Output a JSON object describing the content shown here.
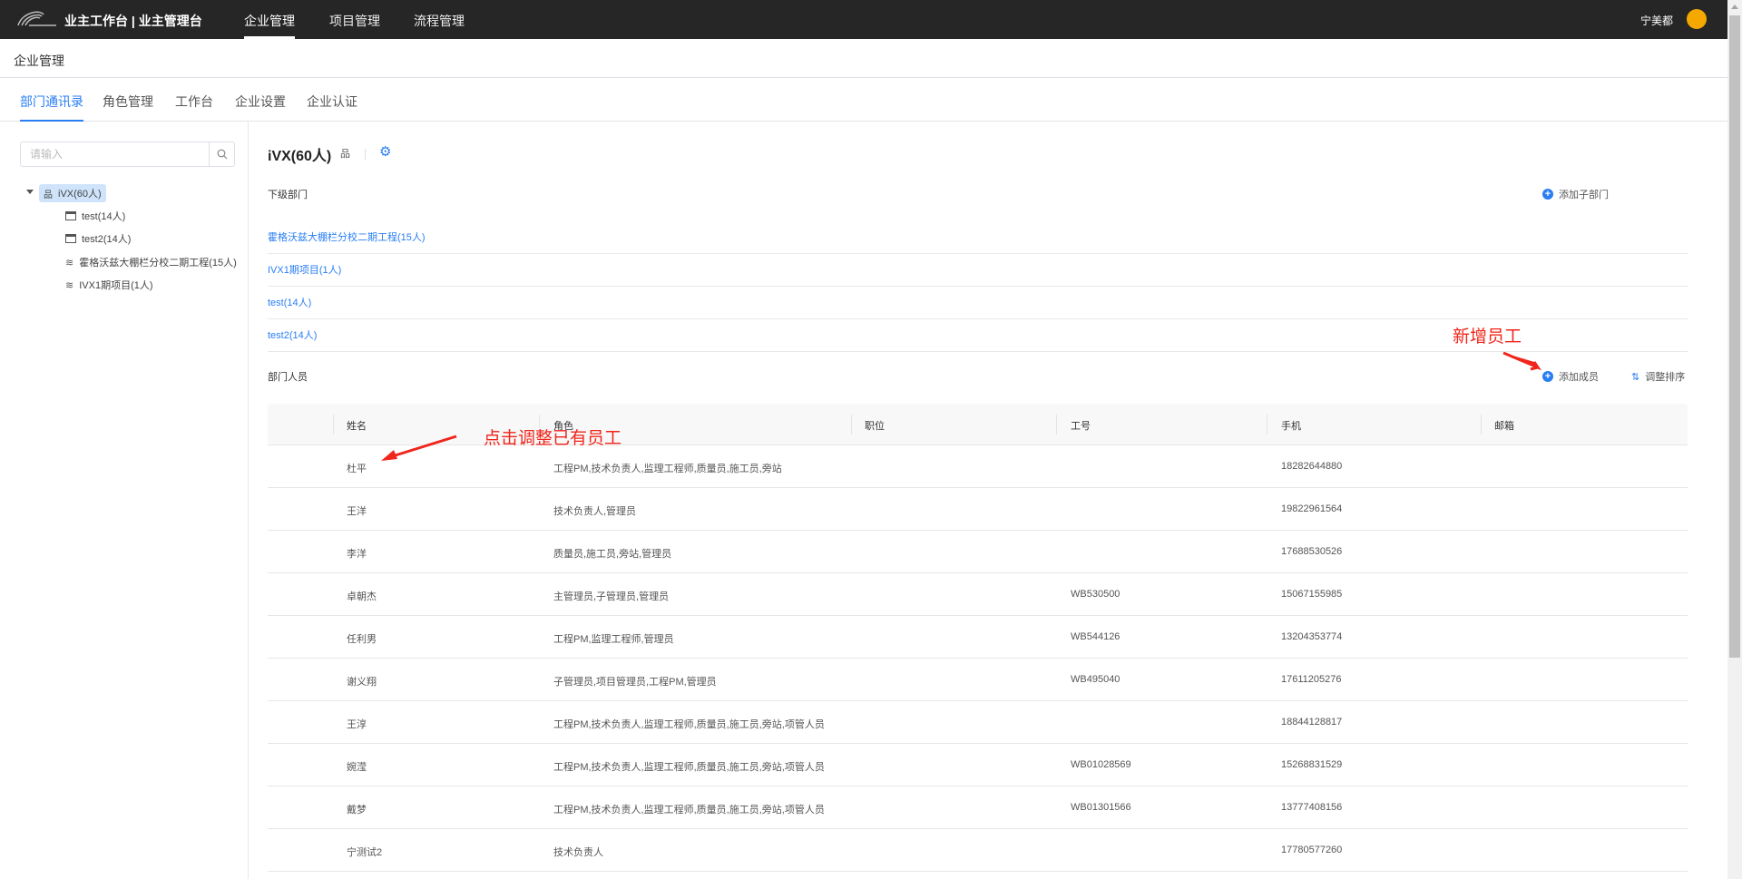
{
  "topbar": {
    "app_title": "业主工作台 | 业主管理台",
    "nav": [
      "企业管理",
      "项目管理",
      "流程管理"
    ],
    "user_name": "宁美都"
  },
  "breadcrumb": "企业管理",
  "tabs": [
    "部门通讯录",
    "角色管理",
    "工作台",
    "企业设置",
    "企业认证"
  ],
  "sidebar": {
    "search_placeholder": "请输入",
    "tree": [
      "iVX(60人)",
      "test(14人)",
      "test2(14人)",
      "霍格沃兹大棚栏分校二期工程(15人)",
      "IVX1期项目(1人)"
    ]
  },
  "main": {
    "title": "iVX(60人)",
    "sub_dept_label": "下级部门",
    "add_sub_dept": "添加子部门",
    "sub_depts": [
      "霍格沃兹大棚栏分校二期工程(15人)",
      "IVX1期项目(1人)",
      "test(14人)",
      "test2(14人)"
    ],
    "members_label": "部门人员",
    "add_member": "添加成员",
    "sort": "调整排序",
    "columns": [
      "姓名",
      "角色",
      "职位",
      "工号",
      "手机",
      "邮箱"
    ],
    "rows": [
      {
        "name": "杜平",
        "role": "工程PM,技术负责人,监理工程师,质量员,施工员,旁站",
        "title": "",
        "id": "",
        "phone": "18282644880",
        "email": ""
      },
      {
        "name": "王洋",
        "role": "技术负责人,管理员",
        "title": "",
        "id": "",
        "phone": "19822961564",
        "email": ""
      },
      {
        "name": "李洋",
        "role": "质量员,施工员,旁站,管理员",
        "title": "",
        "id": "",
        "phone": "17688530526",
        "email": ""
      },
      {
        "name": "卓朝杰",
        "role": "主管理员,子管理员,管理员",
        "title": "",
        "id": "WB530500",
        "phone": "15067155985",
        "email": ""
      },
      {
        "name": "任利男",
        "role": "工程PM,监理工程师,管理员",
        "title": "",
        "id": "WB544126",
        "phone": "13204353774",
        "email": ""
      },
      {
        "name": "谢义翔",
        "role": "子管理员,项目管理员,工程PM,管理员",
        "title": "",
        "id": "WB495040",
        "phone": "17611205276",
        "email": ""
      },
      {
        "name": "王淳",
        "role": "工程PM,技术负责人,监理工程师,质量员,施工员,旁站,项管人员",
        "title": "",
        "id": "",
        "phone": "18844128817",
        "email": ""
      },
      {
        "name": "婉滢",
        "role": "工程PM,技术负责人,监理工程师,质量员,施工员,旁站,项管人员",
        "title": "",
        "id": "WB01028569",
        "phone": "15268831529",
        "email": ""
      },
      {
        "name": "戴梦",
        "role": "工程PM,技术负责人,监理工程师,质量员,施工员,旁站,项管人员",
        "title": "",
        "id": "WB01301566",
        "phone": "13777408156",
        "email": ""
      },
      {
        "name": "宁测试2",
        "role": "技术负责人",
        "title": "",
        "id": "",
        "phone": "17780577260",
        "email": ""
      }
    ]
  },
  "annotations": {
    "add_employee": "新增员工",
    "edit_employee": "点击调整已有员工"
  },
  "colors": {
    "accent": "#2a7ef4",
    "topbar": "#262626",
    "annotation": "#f0251b"
  }
}
